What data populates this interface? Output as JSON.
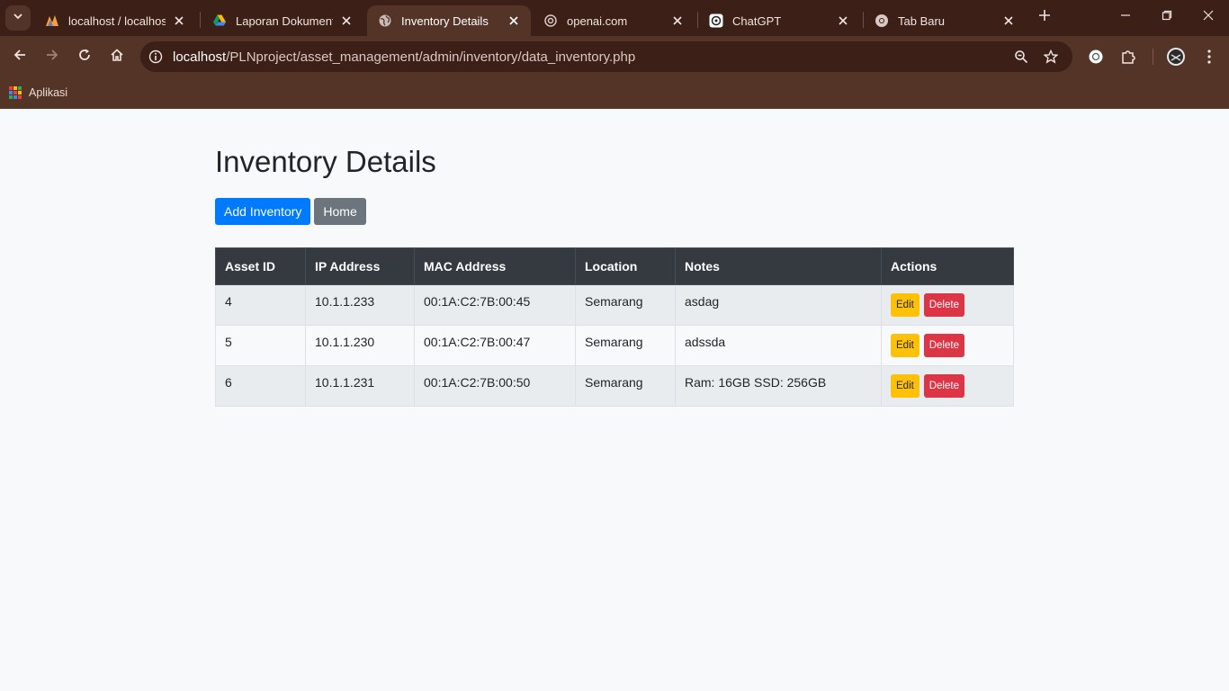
{
  "browser": {
    "tabs": [
      {
        "title": "localhost / localhost /",
        "icon": "phpmyadmin-icon"
      },
      {
        "title": "Laporan Dokumentasi",
        "icon": "google-drive-icon"
      },
      {
        "title": "Inventory Details",
        "icon": "globe-icon"
      },
      {
        "title": "openai.com",
        "icon": "openai-icon"
      },
      {
        "title": "ChatGPT",
        "icon": "chatgpt-icon"
      },
      {
        "title": "Tab Baru",
        "icon": "chrome-icon"
      }
    ],
    "active_tab": 2,
    "url_host": "localhost",
    "url_path": "/PLNproject/asset_management/admin/inventory/data_inventory.php",
    "bookmark": "Aplikasi",
    "colors": {
      "frame": "#3c1f17",
      "toolbar": "#553428"
    }
  },
  "page": {
    "title": "Inventory Details",
    "buttons": {
      "add": "Add Inventory",
      "home": "Home"
    },
    "table": {
      "headers": [
        "Asset ID",
        "IP Address",
        "MAC Address",
        "Location",
        "Notes",
        "Actions"
      ],
      "rows": [
        {
          "asset_id": "4",
          "ip": "10.1.1.233",
          "mac": "00:1A:C2:7B:00:45",
          "location": "Semarang",
          "notes": "asdag"
        },
        {
          "asset_id": "5",
          "ip": "10.1.1.230",
          "mac": "00:1A:C2:7B:00:47",
          "location": "Semarang",
          "notes": "adssda"
        },
        {
          "asset_id": "6",
          "ip": "10.1.1.231",
          "mac": "00:1A:C2:7B:00:50",
          "location": "Semarang",
          "notes": "Ram: 16GB SSD: 256GB"
        }
      ],
      "edit_label": "Edit",
      "delete_label": "Delete"
    },
    "colors": {
      "primary": "#007bff",
      "secondary": "#6c757d",
      "warning": "#ffc107",
      "danger": "#dc3545",
      "header": "#343a40"
    }
  }
}
